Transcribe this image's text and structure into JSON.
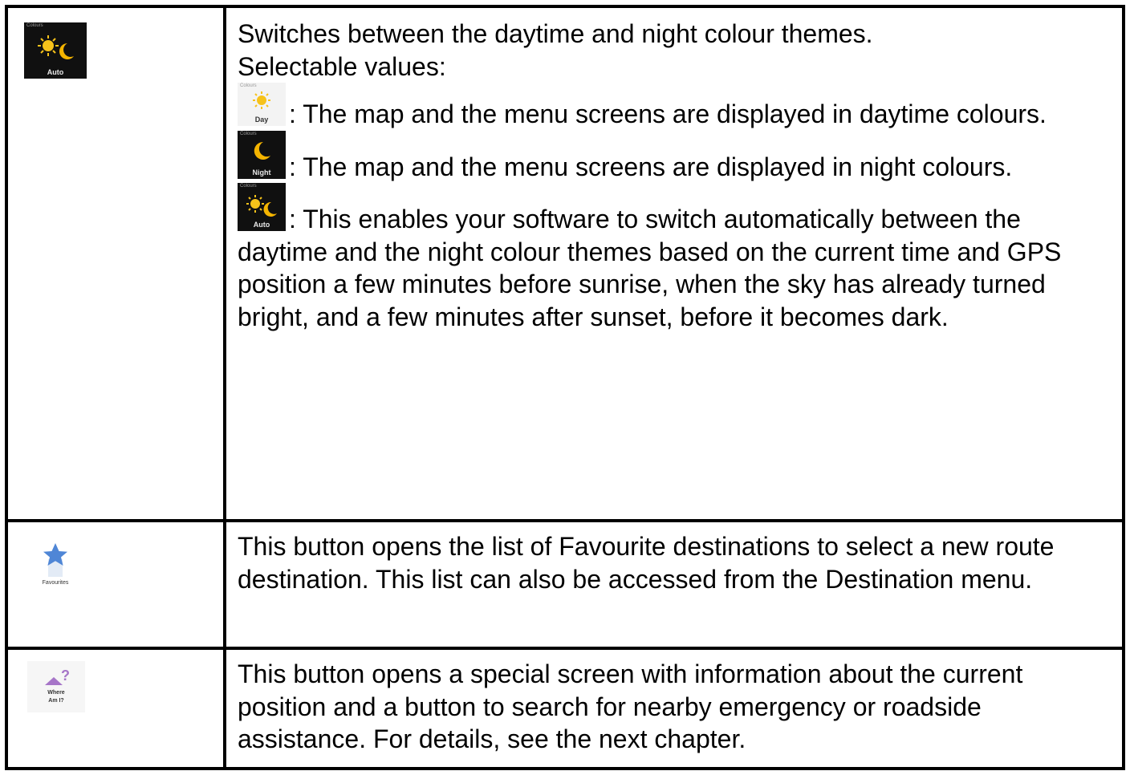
{
  "rows": [
    {
      "icon": {
        "caption": "Colours",
        "label": "Auto",
        "name": "colours-auto-icon"
      },
      "intro": "Switches between the daytime and night colour themes.",
      "selectable": "Selectable values:",
      "options": [
        {
          "icon": {
            "caption": "Colours",
            "label": "Day",
            "name": "colours-day-icon"
          },
          "text": ": The map and the menu screens are displayed in daytime colours."
        },
        {
          "icon": {
            "caption": "Colours",
            "label": "Night",
            "name": "colours-night-icon"
          },
          "text": ": The map and the menu screens are displayed in night colours."
        },
        {
          "icon": {
            "caption": "Colours",
            "label": "Auto",
            "name": "colours-auto-icon"
          },
          "text": ": This enables your software to switch automatically between the daytime and the night colour themes based on the current time and GPS position a few minutes before sunrise, when the sky has already turned bright, and a few minutes after sunset, before it becomes dark."
        }
      ]
    },
    {
      "icon": {
        "label": "Favourites",
        "name": "favourites-star-icon"
      },
      "text": "This button opens the list of Favourite destinations to select a new route destination. This list can also be accessed from the Destination menu."
    },
    {
      "icon": {
        "label_line1": "Where",
        "label_line2": "Am I?",
        "name": "where-am-i-icon"
      },
      "text": "This button opens a special screen with information about the current position and a button to search for nearby emergency or roadside assistance. For details, see the next chapter."
    }
  ],
  "colors": {
    "sun": "#f6c21a",
    "moon": "#f4b400",
    "star": "#4f86d6",
    "where": "#a675c8",
    "border": "#000000"
  }
}
